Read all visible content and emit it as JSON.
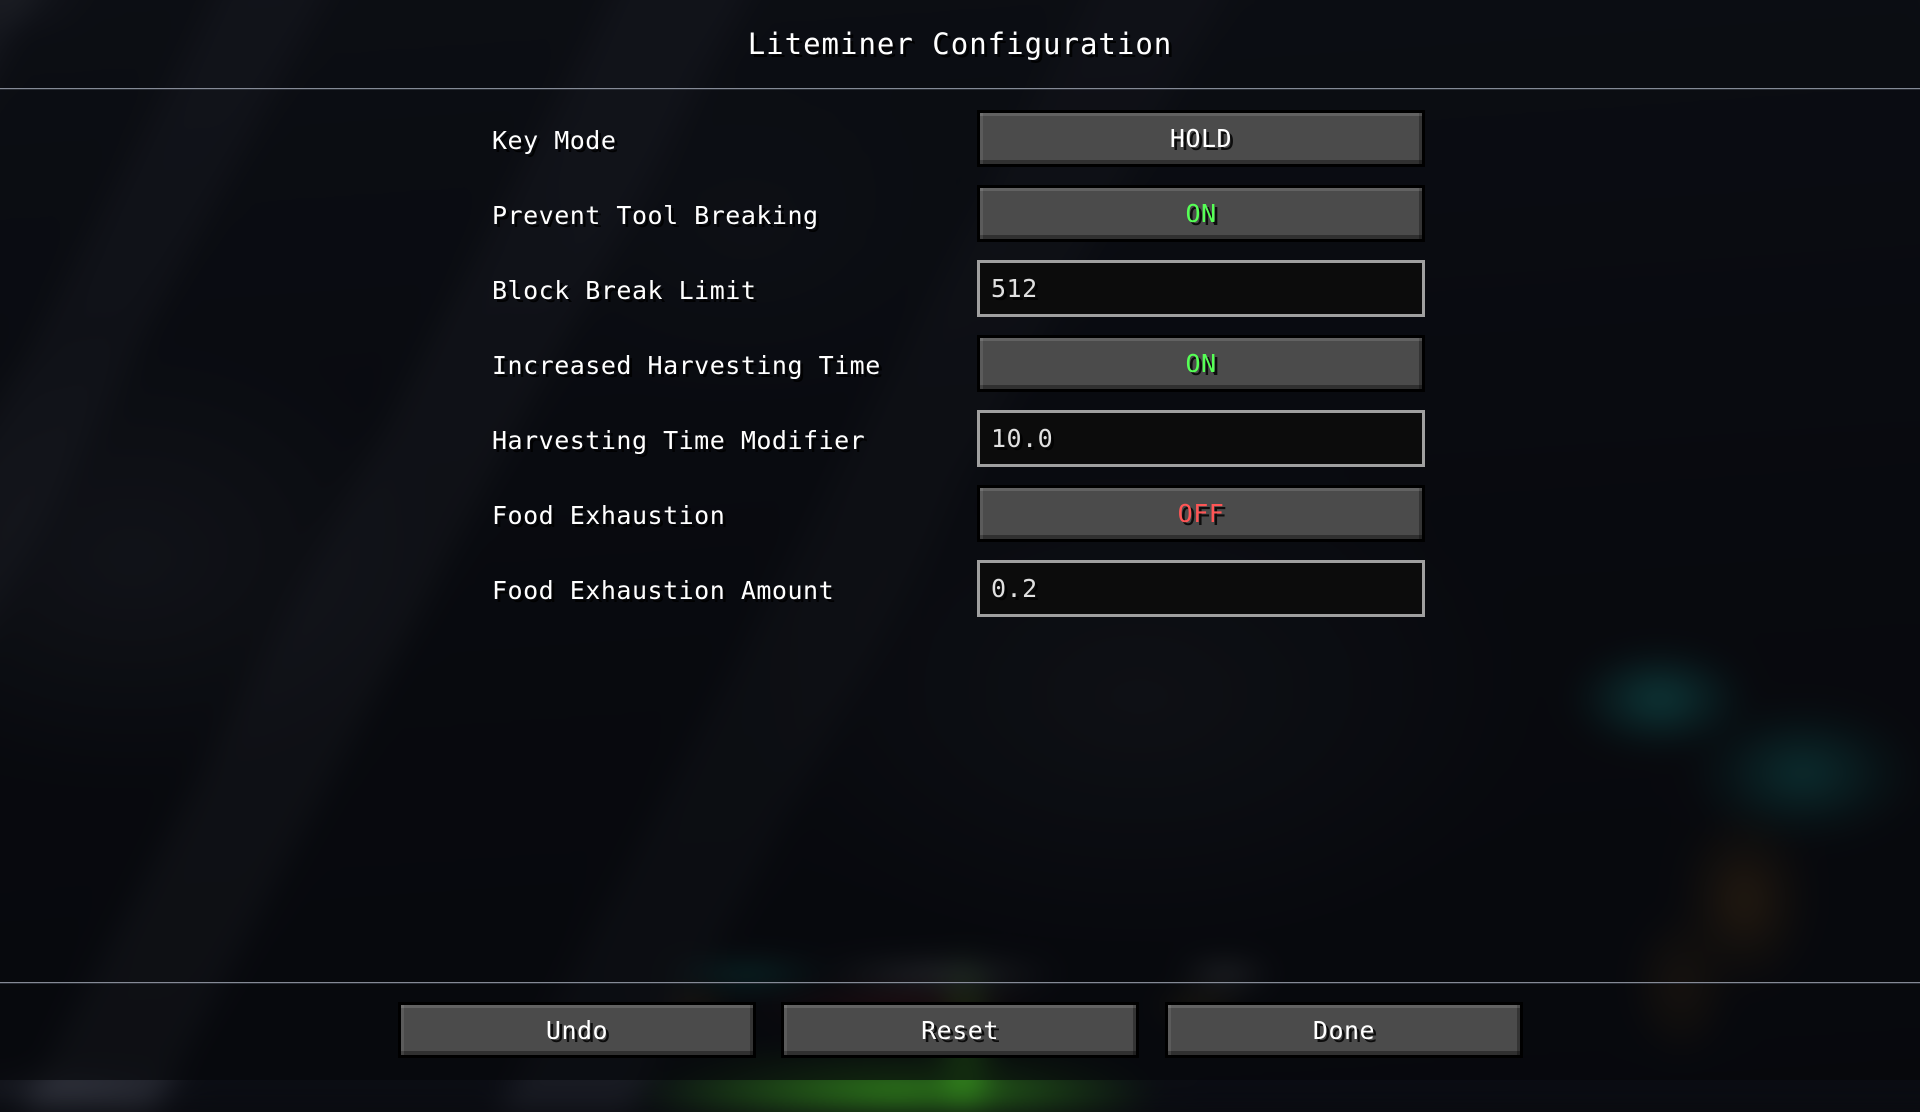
{
  "screen": {
    "title": "Liteminer Configuration"
  },
  "colors": {
    "value_on": "#55FF55",
    "value_off": "#FF5555",
    "button_face": "#4B4B4B",
    "button_border": "#000000",
    "field_fill": "#0C0C0C",
    "field_border": "#A0A0A0",
    "text": "#FFFFFF"
  },
  "options": [
    {
      "label": "Key Mode",
      "widget": "button",
      "value": "HOLD",
      "state": "neutral"
    },
    {
      "label": "Prevent Tool Breaking",
      "widget": "button",
      "value": "ON",
      "state": "on"
    },
    {
      "label": "Block Break Limit",
      "widget": "field",
      "value": "512",
      "state": "neutral"
    },
    {
      "label": "Increased Harvesting Time",
      "widget": "button",
      "value": "ON",
      "state": "on"
    },
    {
      "label": "Harvesting Time Modifier",
      "widget": "field",
      "value": "10.0",
      "state": "neutral"
    },
    {
      "label": "Food Exhaustion",
      "widget": "button",
      "value": "OFF",
      "state": "off"
    },
    {
      "label": "Food Exhaustion Amount",
      "widget": "field",
      "value": "0.2",
      "state": "neutral"
    }
  ],
  "footer": {
    "undo_label": "Undo",
    "reset_label": "Reset",
    "done_label": "Done"
  }
}
